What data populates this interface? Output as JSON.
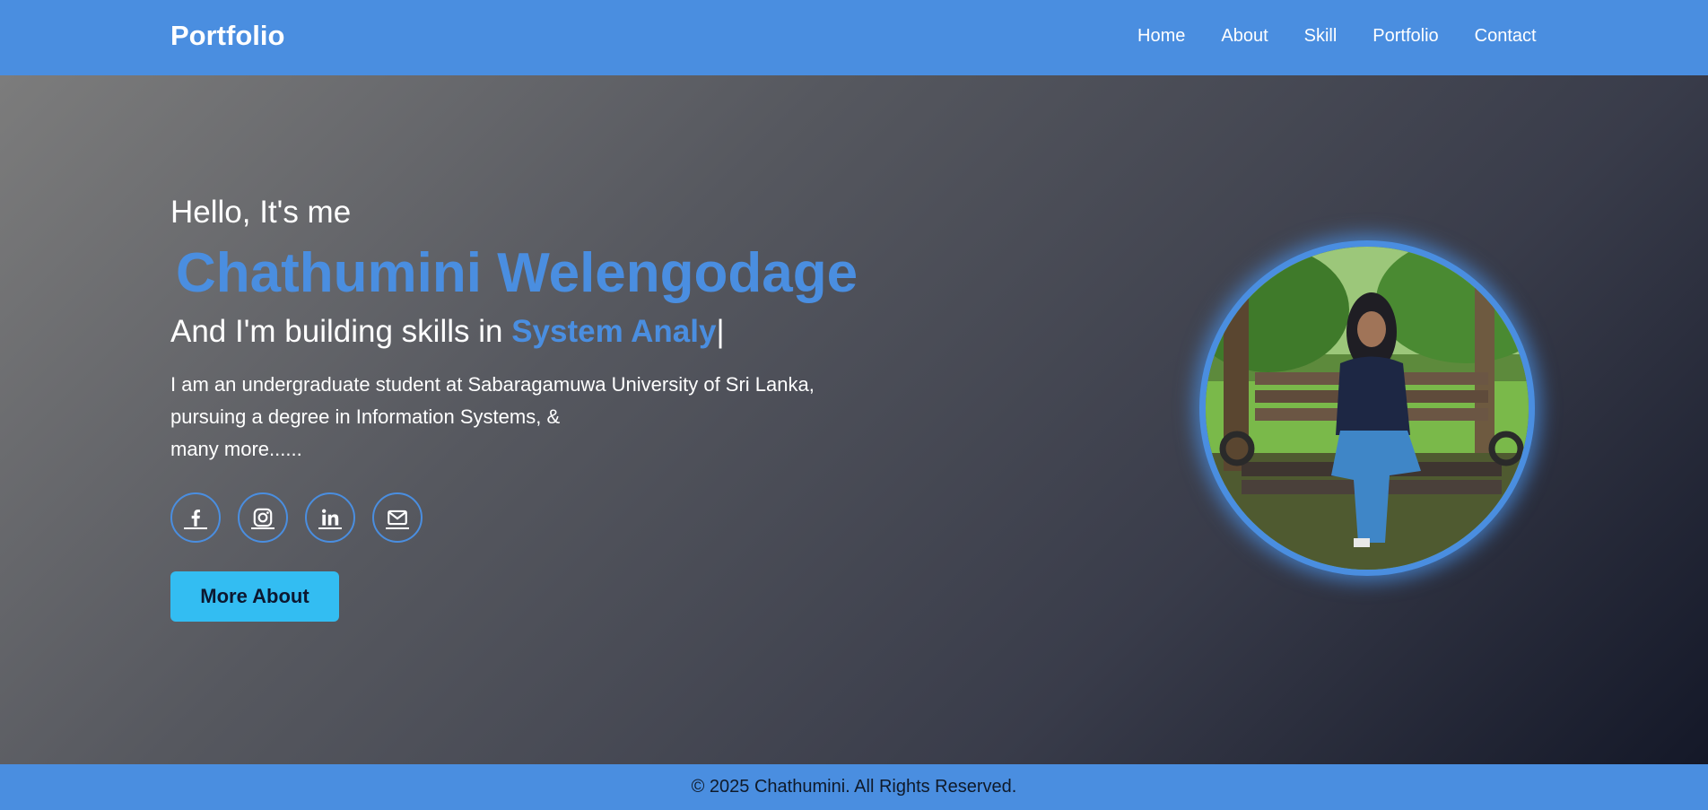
{
  "nav": {
    "logo": "Portfolio",
    "links": [
      "Home",
      "About",
      "Skill",
      "Portfolio",
      "Contact"
    ]
  },
  "hero": {
    "greeting": "Hello, It's me",
    "name": "Chathumini Welengodage",
    "skills_prefix": "And I'm building skills in",
    "skills_typed": "System Analy",
    "cursor": "|",
    "description_lines": [
      "I am an undergraduate student at Sabaragamuwa University of Sri Lanka,",
      "pursuing a degree in Information Systems, &",
      "many more......"
    ],
    "socials": [
      "facebook-icon",
      "instagram-icon",
      "linkedin-icon",
      "email-icon"
    ],
    "button_label": "More About"
  },
  "footer": {
    "text": "© 2025 Chathumini. All Rights Reserved."
  },
  "colors": {
    "accent": "#4a8ee0",
    "button": "#33bdf2"
  }
}
